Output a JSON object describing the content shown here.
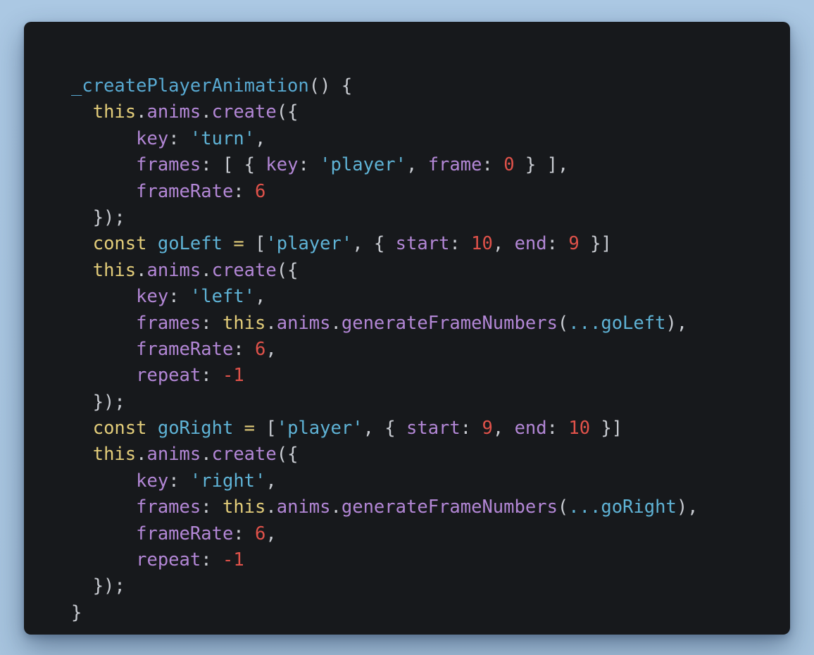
{
  "code": {
    "language": "javascript",
    "lines": [
      [
        {
          "t": "_createPlayerAnimation",
          "c": "fn"
        },
        {
          "t": "() {",
          "c": "punc"
        }
      ],
      [
        {
          "t": "  ",
          "c": "punc"
        },
        {
          "t": "this",
          "c": "kw"
        },
        {
          "t": ".",
          "c": "punc"
        },
        {
          "t": "anims",
          "c": "prop"
        },
        {
          "t": ".",
          "c": "punc"
        },
        {
          "t": "create",
          "c": "prop"
        },
        {
          "t": "({",
          "c": "punc"
        }
      ],
      [
        {
          "t": "      ",
          "c": "punc"
        },
        {
          "t": "key",
          "c": "prop"
        },
        {
          "t": ": ",
          "c": "punc"
        },
        {
          "t": "'turn'",
          "c": "str"
        },
        {
          "t": ",",
          "c": "punc"
        }
      ],
      [
        {
          "t": "      ",
          "c": "punc"
        },
        {
          "t": "frames",
          "c": "prop"
        },
        {
          "t": ": [ { ",
          "c": "punc"
        },
        {
          "t": "key",
          "c": "prop"
        },
        {
          "t": ": ",
          "c": "punc"
        },
        {
          "t": "'player'",
          "c": "str"
        },
        {
          "t": ", ",
          "c": "punc"
        },
        {
          "t": "frame",
          "c": "prop"
        },
        {
          "t": ": ",
          "c": "punc"
        },
        {
          "t": "0",
          "c": "num"
        },
        {
          "t": " } ],",
          "c": "punc"
        }
      ],
      [
        {
          "t": "      ",
          "c": "punc"
        },
        {
          "t": "frameRate",
          "c": "prop"
        },
        {
          "t": ": ",
          "c": "punc"
        },
        {
          "t": "6",
          "c": "num"
        }
      ],
      [
        {
          "t": "  });",
          "c": "punc"
        }
      ],
      [
        {
          "t": "  ",
          "c": "punc"
        },
        {
          "t": "const",
          "c": "kw"
        },
        {
          "t": " ",
          "c": "punc"
        },
        {
          "t": "goLeft",
          "c": "var"
        },
        {
          "t": " ",
          "c": "punc"
        },
        {
          "t": "=",
          "c": "kw"
        },
        {
          "t": " [",
          "c": "punc"
        },
        {
          "t": "'player'",
          "c": "str"
        },
        {
          "t": ", { ",
          "c": "punc"
        },
        {
          "t": "start",
          "c": "prop"
        },
        {
          "t": ": ",
          "c": "punc"
        },
        {
          "t": "10",
          "c": "num"
        },
        {
          "t": ", ",
          "c": "punc"
        },
        {
          "t": "end",
          "c": "prop"
        },
        {
          "t": ": ",
          "c": "punc"
        },
        {
          "t": "9",
          "c": "num"
        },
        {
          "t": " }]",
          "c": "punc"
        }
      ],
      [
        {
          "t": "  ",
          "c": "punc"
        },
        {
          "t": "this",
          "c": "kw"
        },
        {
          "t": ".",
          "c": "punc"
        },
        {
          "t": "anims",
          "c": "prop"
        },
        {
          "t": ".",
          "c": "punc"
        },
        {
          "t": "create",
          "c": "prop"
        },
        {
          "t": "({",
          "c": "punc"
        }
      ],
      [
        {
          "t": "      ",
          "c": "punc"
        },
        {
          "t": "key",
          "c": "prop"
        },
        {
          "t": ": ",
          "c": "punc"
        },
        {
          "t": "'left'",
          "c": "str"
        },
        {
          "t": ",",
          "c": "punc"
        }
      ],
      [
        {
          "t": "      ",
          "c": "punc"
        },
        {
          "t": "frames",
          "c": "prop"
        },
        {
          "t": ": ",
          "c": "punc"
        },
        {
          "t": "this",
          "c": "kw"
        },
        {
          "t": ".",
          "c": "punc"
        },
        {
          "t": "anims",
          "c": "prop"
        },
        {
          "t": ".",
          "c": "punc"
        },
        {
          "t": "generateFrameNumbers",
          "c": "prop"
        },
        {
          "t": "(",
          "c": "punc"
        },
        {
          "t": "...goLeft",
          "c": "var"
        },
        {
          "t": "),",
          "c": "punc"
        }
      ],
      [
        {
          "t": "      ",
          "c": "punc"
        },
        {
          "t": "frameRate",
          "c": "prop"
        },
        {
          "t": ": ",
          "c": "punc"
        },
        {
          "t": "6",
          "c": "num"
        },
        {
          "t": ",",
          "c": "punc"
        }
      ],
      [
        {
          "t": "      ",
          "c": "punc"
        },
        {
          "t": "repeat",
          "c": "prop"
        },
        {
          "t": ": ",
          "c": "punc"
        },
        {
          "t": "-1",
          "c": "num"
        }
      ],
      [
        {
          "t": "  });",
          "c": "punc"
        }
      ],
      [
        {
          "t": "  ",
          "c": "punc"
        },
        {
          "t": "const",
          "c": "kw"
        },
        {
          "t": " ",
          "c": "punc"
        },
        {
          "t": "goRight",
          "c": "var"
        },
        {
          "t": " ",
          "c": "punc"
        },
        {
          "t": "=",
          "c": "kw"
        },
        {
          "t": " [",
          "c": "punc"
        },
        {
          "t": "'player'",
          "c": "str"
        },
        {
          "t": ", { ",
          "c": "punc"
        },
        {
          "t": "start",
          "c": "prop"
        },
        {
          "t": ": ",
          "c": "punc"
        },
        {
          "t": "9",
          "c": "num"
        },
        {
          "t": ", ",
          "c": "punc"
        },
        {
          "t": "end",
          "c": "prop"
        },
        {
          "t": ": ",
          "c": "punc"
        },
        {
          "t": "10",
          "c": "num"
        },
        {
          "t": " }]",
          "c": "punc"
        }
      ],
      [
        {
          "t": "  ",
          "c": "punc"
        },
        {
          "t": "this",
          "c": "kw"
        },
        {
          "t": ".",
          "c": "punc"
        },
        {
          "t": "anims",
          "c": "prop"
        },
        {
          "t": ".",
          "c": "punc"
        },
        {
          "t": "create",
          "c": "prop"
        },
        {
          "t": "({",
          "c": "punc"
        }
      ],
      [
        {
          "t": "      ",
          "c": "punc"
        },
        {
          "t": "key",
          "c": "prop"
        },
        {
          "t": ": ",
          "c": "punc"
        },
        {
          "t": "'right'",
          "c": "str"
        },
        {
          "t": ",",
          "c": "punc"
        }
      ],
      [
        {
          "t": "      ",
          "c": "punc"
        },
        {
          "t": "frames",
          "c": "prop"
        },
        {
          "t": ": ",
          "c": "punc"
        },
        {
          "t": "this",
          "c": "kw"
        },
        {
          "t": ".",
          "c": "punc"
        },
        {
          "t": "anims",
          "c": "prop"
        },
        {
          "t": ".",
          "c": "punc"
        },
        {
          "t": "generateFrameNumbers",
          "c": "prop"
        },
        {
          "t": "(",
          "c": "punc"
        },
        {
          "t": "...goRight",
          "c": "var"
        },
        {
          "t": "),",
          "c": "punc"
        }
      ],
      [
        {
          "t": "      ",
          "c": "punc"
        },
        {
          "t": "frameRate",
          "c": "prop"
        },
        {
          "t": ": ",
          "c": "punc"
        },
        {
          "t": "6",
          "c": "num"
        },
        {
          "t": ",",
          "c": "punc"
        }
      ],
      [
        {
          "t": "      ",
          "c": "punc"
        },
        {
          "t": "repeat",
          "c": "prop"
        },
        {
          "t": ": ",
          "c": "punc"
        },
        {
          "t": "-1",
          "c": "num"
        }
      ],
      [
        {
          "t": "  });",
          "c": "punc"
        }
      ],
      [
        {
          "t": "}",
          "c": "punc"
        }
      ]
    ]
  },
  "theme": {
    "background": "#17191c",
    "outer_background": "#abc8e3",
    "function_color": "#58a9d1",
    "keyword_color": "#e3cd7a",
    "property_color": "#b387d6",
    "string_color": "#5fb3d6",
    "number_color": "#e0524a",
    "punctuation_color": "#c9ccd2"
  }
}
